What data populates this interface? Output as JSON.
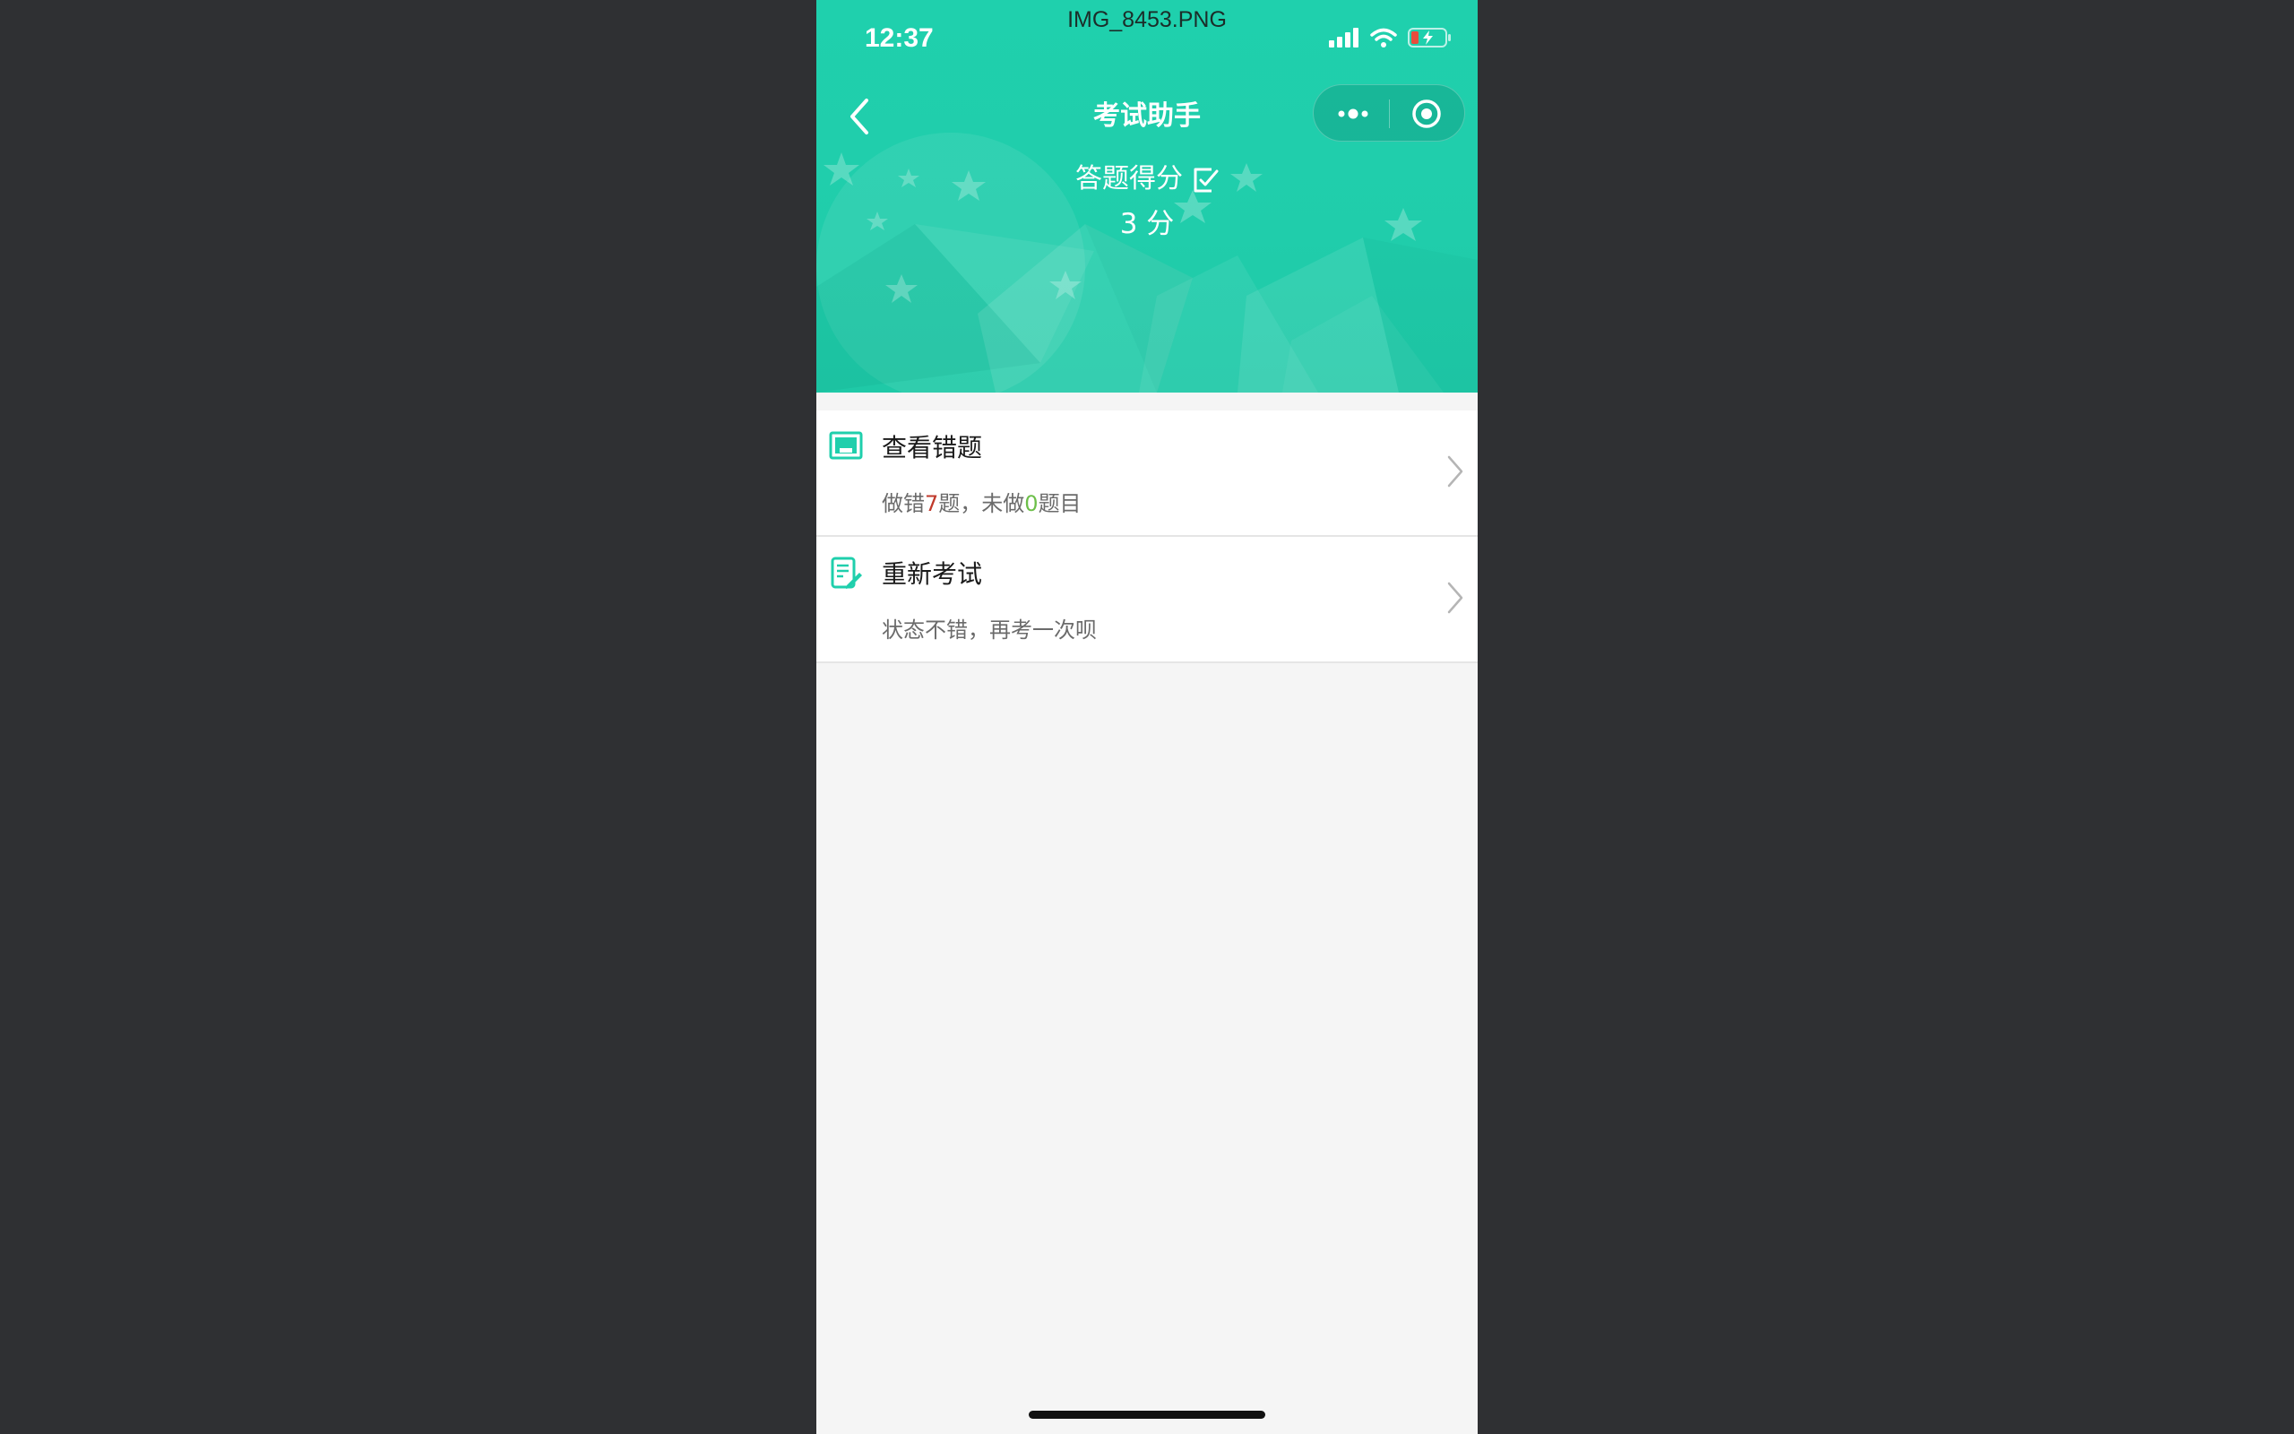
{
  "status_bar": {
    "time": "12:37",
    "filename": "IMG_8453.PNG",
    "icons": [
      "signal-icon",
      "wifi-icon",
      "battery-icon"
    ]
  },
  "nav": {
    "title": "考试助手",
    "back_icon": "chevron-left-icon",
    "capsule_icons": [
      "more-icon",
      "target-icon"
    ]
  },
  "score": {
    "label": "答题得分",
    "value": "3 分",
    "edit_icon": "edit-icon"
  },
  "list": {
    "items": [
      {
        "icon": "review-icon",
        "title": "查看错题",
        "desc_prefix": "做错",
        "wrong_count": "7",
        "desc_middle": "题，未做",
        "undone_count": "0",
        "desc_suffix": "题目"
      },
      {
        "icon": "exam-edit-icon",
        "title": "重新考试",
        "desc": "状态不错，再考一次呗"
      }
    ]
  },
  "colors": {
    "accent": "#1fcfac",
    "wrong": "#c0392b",
    "undone": "#6dbf4a"
  }
}
